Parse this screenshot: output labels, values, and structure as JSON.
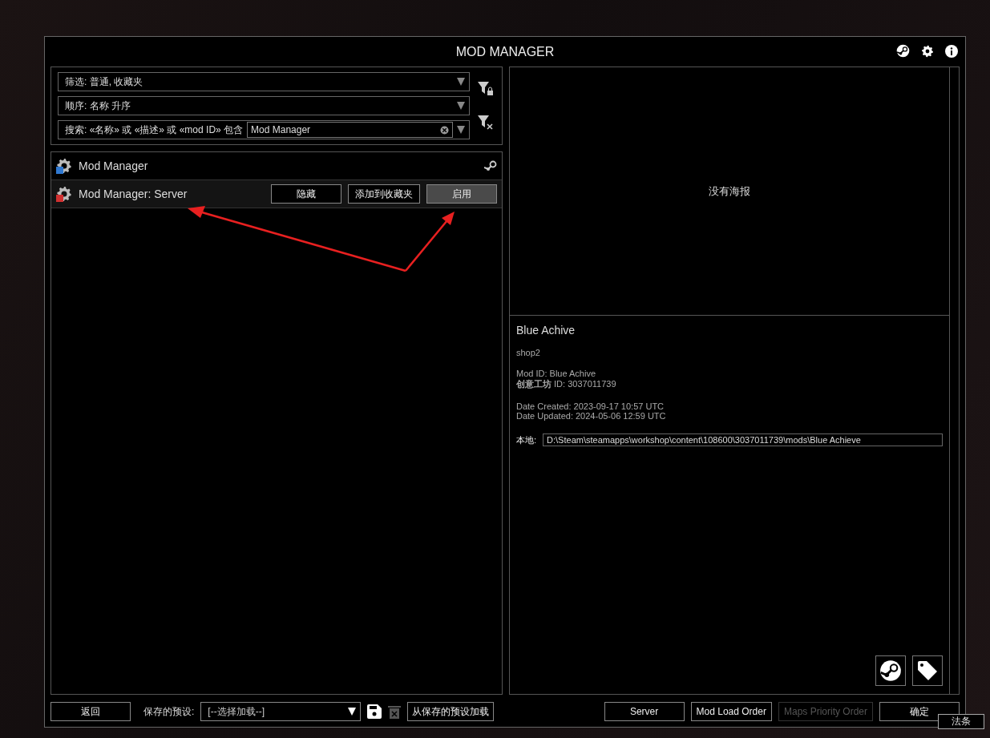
{
  "window": {
    "title": "MOD MANAGER"
  },
  "filters": [
    {
      "kind": "dropdown",
      "label": "筛选: 普通, 收藏夹"
    },
    {
      "kind": "dropdown",
      "label": "顺序: 名称 升序"
    },
    {
      "kind": "search",
      "label": "搜索: «名称» 或 «描述» 或 «mod ID» 包含",
      "value": "Mod Manager"
    }
  ],
  "mods": [
    {
      "name": "Mod Manager",
      "color": "#2f78d0",
      "selected": false,
      "workshop": true
    },
    {
      "name": "Mod Manager: Server",
      "color": "#d03030",
      "selected": true,
      "workshop": false,
      "buttons": [
        {
          "label": "隐藏",
          "highlighted": false
        },
        {
          "label": "添加到收藏夹",
          "highlighted": false
        },
        {
          "label": "启用",
          "highlighted": true
        }
      ]
    }
  ],
  "preview": {
    "placeholder_text": "没有海报"
  },
  "details": {
    "title": "Blue Achive",
    "description": "shop2",
    "mod_id": "Mod ID: Blue Achive",
    "workshop_id": "**创意工坊** ID: 3037011739",
    "created": "Date Created: 2023-09-17 10:57 UTC",
    "updated": "Date Updated: 2024-05-06 12:59 UTC",
    "local_label": "本地:",
    "local_path": "D:\\Steam\\steamapps\\workshop\\content\\108600\\3037011739\\mods\\Blue Achieve"
  },
  "footer": {
    "back": "返回",
    "preset_label": "保存的预设:",
    "preset_placeholder": "[--选择加载--]",
    "delete_disabled": true,
    "load_preset": "从保存的预设加载",
    "right_buttons": [
      {
        "label": "Server",
        "disabled": false
      },
      {
        "label": "Mod Load Order",
        "disabled": false
      },
      {
        "label": "Maps Priority Order",
        "disabled": true
      },
      {
        "label": "确定",
        "disabled": false
      }
    ]
  },
  "tooltip": "法条"
}
